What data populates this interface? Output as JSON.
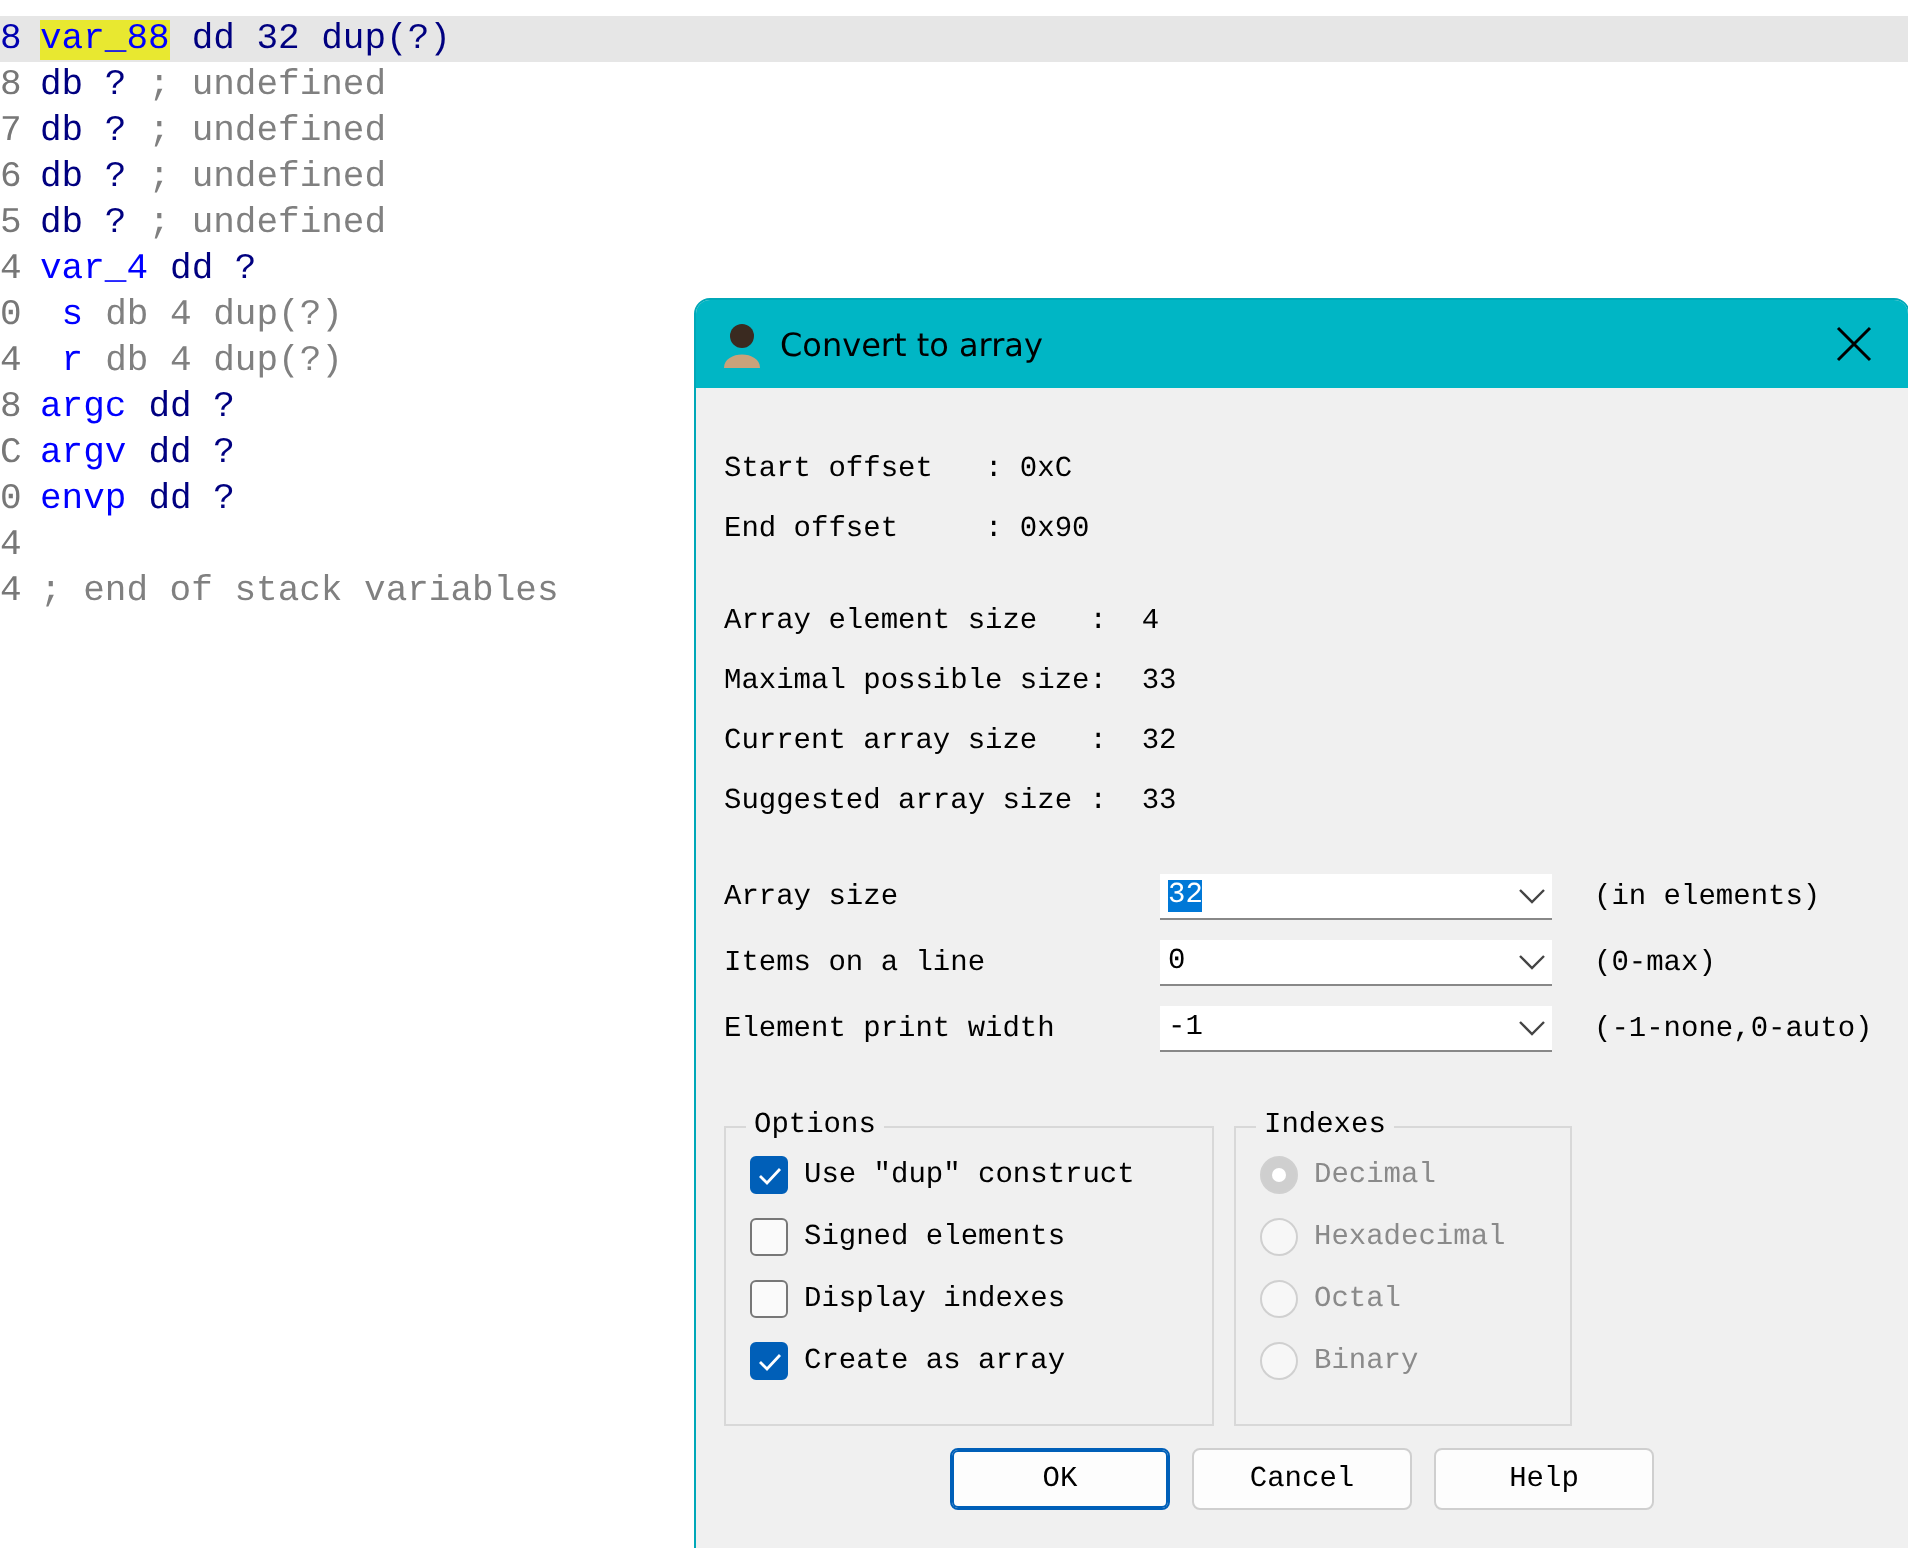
{
  "code_lines": [
    {
      "address": "8",
      "selected": true,
      "tokens": [
        {
          "text": "var_88",
          "kind": "name",
          "highlighted": true
        },
        {
          "text": "dd 32 dup(?)",
          "kind": "directive",
          "highlighted": false
        }
      ]
    },
    {
      "address": "8",
      "selected": false,
      "tokens": [
        {
          "text": "db ?",
          "kind": "directive",
          "highlighted": false
        },
        {
          "text": "; undefined",
          "kind": "comment",
          "highlighted": false
        }
      ]
    },
    {
      "address": "7",
      "selected": false,
      "tokens": [
        {
          "text": "db ?",
          "kind": "directive",
          "highlighted": false
        },
        {
          "text": "; undefined",
          "kind": "comment",
          "highlighted": false
        }
      ]
    },
    {
      "address": "6",
      "selected": false,
      "tokens": [
        {
          "text": "db ?",
          "kind": "directive",
          "highlighted": false
        },
        {
          "text": "; undefined",
          "kind": "comment",
          "highlighted": false
        }
      ]
    },
    {
      "address": "5",
      "selected": false,
      "tokens": [
        {
          "text": "db ?",
          "kind": "directive",
          "highlighted": false
        },
        {
          "text": "; undefined",
          "kind": "comment",
          "highlighted": false
        }
      ]
    },
    {
      "address": "4",
      "selected": false,
      "tokens": [
        {
          "text": "var_4",
          "kind": "name",
          "highlighted": false
        },
        {
          "text": "dd ?",
          "kind": "directive",
          "highlighted": false
        }
      ]
    },
    {
      "address": "0",
      "selected": false,
      "tokens": [
        {
          "text": " s",
          "kind": "name",
          "highlighted": false
        },
        {
          "text": "db 4 dup(?)",
          "kind": "comment",
          "highlighted": false
        }
      ]
    },
    {
      "address": "4",
      "selected": false,
      "tokens": [
        {
          "text": " r",
          "kind": "name",
          "highlighted": false
        },
        {
          "text": "db 4 dup(?)",
          "kind": "comment",
          "highlighted": false
        }
      ]
    },
    {
      "address": "8",
      "selected": false,
      "tokens": [
        {
          "text": "argc",
          "kind": "name",
          "highlighted": false
        },
        {
          "text": "dd ?",
          "kind": "directive",
          "highlighted": false
        }
      ]
    },
    {
      "address": "C",
      "selected": false,
      "tokens": [
        {
          "text": "argv",
          "kind": "name",
          "highlighted": false
        },
        {
          "text": "dd ?",
          "kind": "directive",
          "highlighted": false
        }
      ]
    },
    {
      "address": "0",
      "selected": false,
      "tokens": [
        {
          "text": "envp",
          "kind": "name",
          "highlighted": false
        },
        {
          "text": "dd ?",
          "kind": "directive",
          "highlighted": false
        }
      ]
    },
    {
      "address": "4",
      "selected": false
    },
    {
      "address": "4",
      "selected": false,
      "tokens": [
        {
          "text": "; end of stack variables",
          "kind": "comment",
          "highlighted": false
        }
      ]
    }
  ],
  "dialog": {
    "title": "Convert to array",
    "info_groups": [
      [
        "Start offset   : 0xC",
        "End offset     : 0x90"
      ],
      [
        "Array element size   :  4",
        "Maximal possible size:  33",
        "Current array size   :  32",
        "Suggested array size :  33"
      ]
    ],
    "fields": [
      {
        "label": "Array size",
        "value": "32",
        "value_selected": true,
        "hint": "(in elements)"
      },
      {
        "label": "Items on a line",
        "value": "0",
        "value_selected": false,
        "hint": "(0-max)"
      },
      {
        "label": "Element print width",
        "value": "-1",
        "value_selected": false,
        "hint": "(-1-none,0-auto)"
      }
    ],
    "options": {
      "title": "Options",
      "items": [
        {
          "label": "Use \"dup\" construct",
          "checked": true
        },
        {
          "label": "Signed elements",
          "checked": false
        },
        {
          "label": "Display indexes",
          "checked": false
        },
        {
          "label": "Create as array",
          "checked": true
        }
      ]
    },
    "indexes": {
      "title": "Indexes",
      "items": [
        {
          "label": "Decimal",
          "selected": true,
          "disabled": true
        },
        {
          "label": "Hexadecimal",
          "selected": false,
          "disabled": true
        },
        {
          "label": "Octal",
          "selected": false,
          "disabled": true
        },
        {
          "label": "Binary",
          "selected": false,
          "disabled": true
        }
      ]
    },
    "buttons": [
      {
        "label": "OK",
        "default": true
      },
      {
        "label": "Cancel",
        "default": false
      },
      {
        "label": "Help",
        "default": false
      }
    ]
  }
}
